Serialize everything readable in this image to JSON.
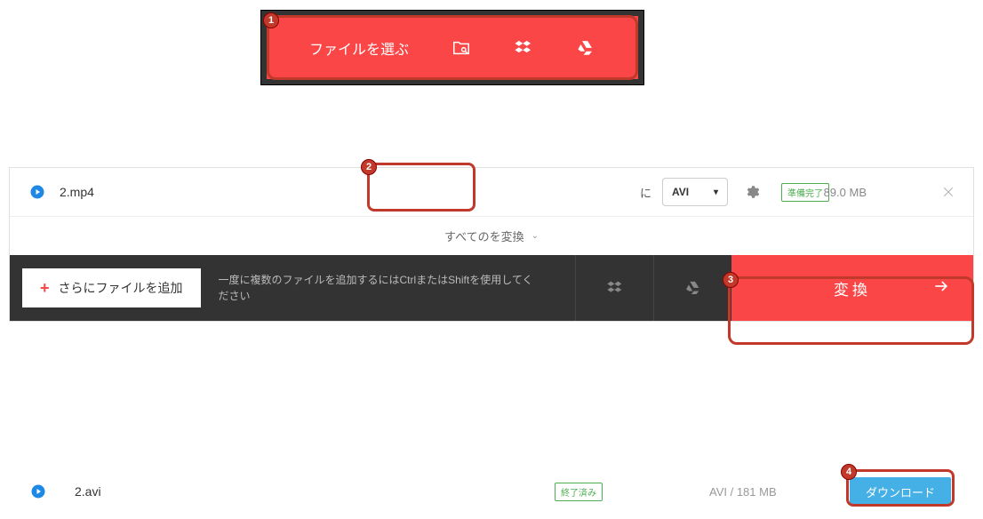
{
  "step1": {
    "choose_label": "ファイルを選ぶ"
  },
  "file": {
    "name": "2.mp4",
    "to_label": "に",
    "format": "AVI",
    "status": "準備完了",
    "size": "89.0 MB"
  },
  "convert_all_label": "すべてのを変換",
  "bottom": {
    "add_more": "さらにファイルを追加",
    "tip": "一度に複数のファイルを追加するにはCtrlまたはShiftを使用してください",
    "convert": "変換"
  },
  "result": {
    "name": "2.avi",
    "done": "終了済み",
    "info": "AVI / 181 MB",
    "download": "ダウンロード"
  },
  "badges": {
    "b1": "1",
    "b2": "2",
    "b3": "3",
    "b4": "4"
  }
}
